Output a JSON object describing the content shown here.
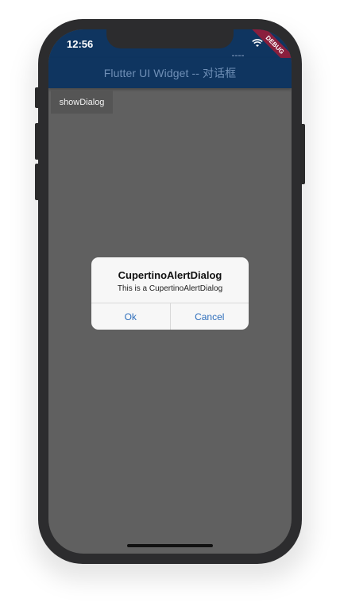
{
  "status_bar": {
    "time": "12:56",
    "debug_banner": "DEBUG"
  },
  "app_bar": {
    "title": "Flutter UI Widget -- 对话框"
  },
  "body": {
    "show_dialog_label": "showDialog"
  },
  "dialog": {
    "title": "CupertinoAlertDialog",
    "content": "This is a CupertinoAlertDialog",
    "actions": [
      "Ok",
      "Cancel"
    ]
  },
  "colors": {
    "app_bar": "#0f3560",
    "scrim": "#606060",
    "action_text": "#2f6fbc",
    "debug_banner": "#8a1f3d"
  },
  "icons": [
    "signal-icon",
    "wifi-icon",
    "battery-icon"
  ]
}
